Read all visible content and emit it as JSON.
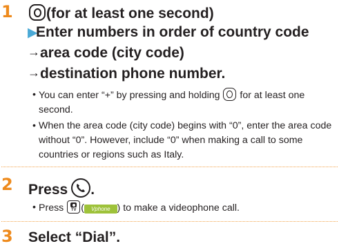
{
  "step1": {
    "number": "1",
    "title_suffix": "(for at least one second)",
    "instruction_line1": "Enter numbers in order of country code",
    "instruction_line2": "area code (city code)",
    "instruction_line3": "destination phone number.",
    "arrow_glyph": "→",
    "notes": [
      {
        "before": "You can enter “+” by pressing and holding ",
        "after": " for at least one second."
      },
      {
        "text": "When the area code (city code) begins with “0”, enter the area code without “0”. However, include “0” when making a call to some countries or regions such as Italy."
      }
    ]
  },
  "step2": {
    "number": "2",
    "title": "Press",
    "title_end": ".",
    "note": {
      "before": "Press ",
      "paren_open": "(",
      "softkey_label": "Vphone",
      "after": ") to make a videophone call."
    },
    "tv_label": "TV"
  },
  "step3": {
    "number": "3",
    "title": "Select “Dial”."
  },
  "bullet_glyph": "•",
  "colors": {
    "step_number": "#ee8a1c",
    "triangle": "#4ba9d6",
    "dotted_rule": "#f2a34a",
    "softkey_bg": "#9ec23a"
  }
}
